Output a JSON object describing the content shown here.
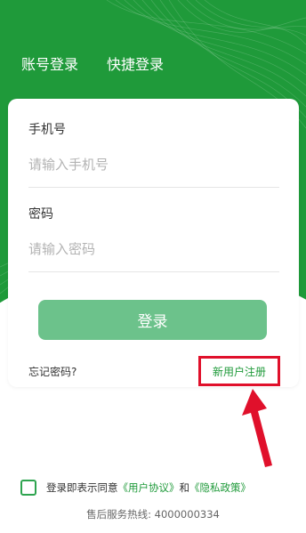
{
  "colors": {
    "brand_green": "#1f9a3a",
    "button_green": "#6cc28b",
    "highlight_red": "#e0102b"
  },
  "tabs": [
    {
      "label": "账号登录"
    },
    {
      "label": "快捷登录"
    }
  ],
  "form": {
    "phone": {
      "label": "手机号",
      "placeholder": "请输入手机号",
      "value": ""
    },
    "password": {
      "label": "密码",
      "placeholder": "请输入密码",
      "value": ""
    },
    "login_label": "登录",
    "forgot_label": "忘记密码?",
    "register_label": "新用户注册"
  },
  "agreement": {
    "checked": false,
    "prefix": "登录即表示同意",
    "user_agreement": "《用户协议》",
    "and": "和",
    "privacy_policy": "《隐私政策》"
  },
  "footer": {
    "hotline": "售后服务热线: 4000000334"
  },
  "icons": {
    "annotation_arrow": "red-arrow-icon",
    "checkbox": "checkbox-icon"
  }
}
